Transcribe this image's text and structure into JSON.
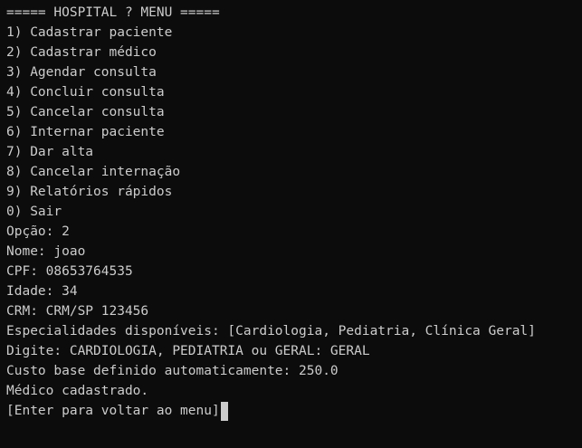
{
  "terminal": {
    "background": "#0c0c0c",
    "foreground": "#cccccc",
    "menu": {
      "header": "===== HOSPITAL ? MENU =====",
      "items": [
        "1) Cadastrar paciente",
        "2) Cadastrar médico",
        "3) Agendar consulta",
        "4) Concluir consulta",
        "5) Cancelar consulta",
        "6) Internar paciente",
        "7) Dar alta",
        "8) Cancelar internação",
        "9) Relatórios rápidos",
        "0) Sair"
      ]
    },
    "session": {
      "option": "Opção: 2",
      "name": "Nome: joao",
      "cpf": "CPF: 08653764535",
      "age": "Idade: 34",
      "crm": "CRM: CRM/SP 123456",
      "specialties": "Especialidades disponíveis: [Cardiologia, Pediatria, Clínica Geral]",
      "type_prompt": "Digite: CARDIOLOGIA, PEDIATRIA ou GERAL: GERAL",
      "base_cost": "Custo base definido automaticamente: 250.0",
      "result": "Médico cadastrado.",
      "return_prompt": "[Enter para voltar ao menu]"
    }
  }
}
